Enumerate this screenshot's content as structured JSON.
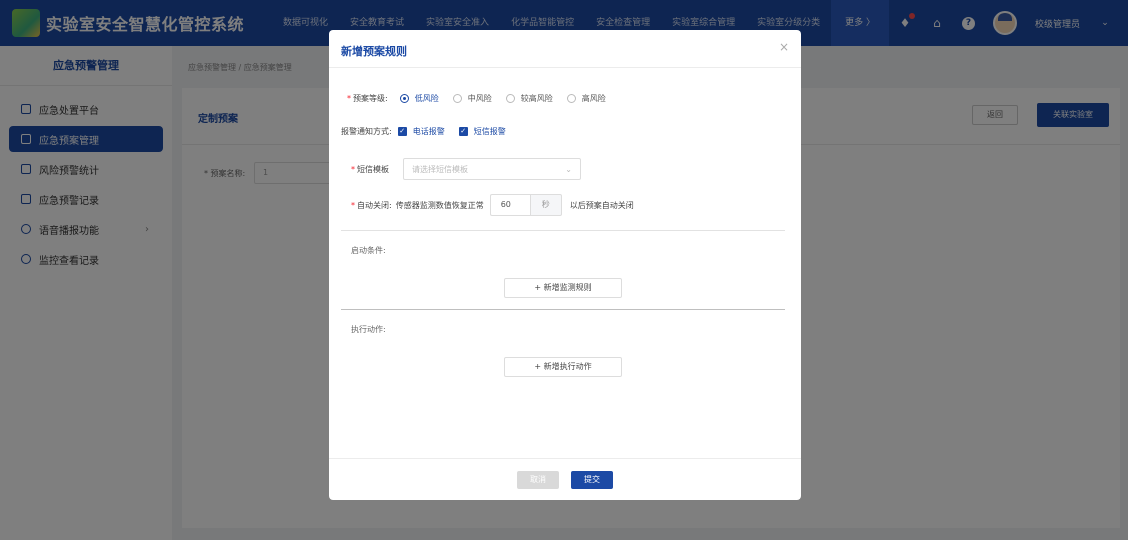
{
  "header": {
    "system_title": "实验室安全智慧化管控系统",
    "nav": [
      "数据可视化",
      "安全教育考试",
      "实验室安全准入",
      "化学品智能管控",
      "安全检查管理",
      "实验室综合管理",
      "实验室分级分类"
    ],
    "more_label": "更多 〉",
    "user_name": "校级管理员"
  },
  "sidebar": {
    "title": "应急预警管理",
    "items": [
      {
        "label": "应急处置平台"
      },
      {
        "label": "应急预案管理"
      },
      {
        "label": "风险预警统计"
      },
      {
        "label": "应急预警记录"
      },
      {
        "label": "语音播报功能"
      },
      {
        "label": "监控查看记录"
      }
    ]
  },
  "background": {
    "breadcrumb": "应急预警管理 / 应急预案管理",
    "card_title": "定制预案",
    "return_button": "返回",
    "link_lab_button": "关联实验室",
    "form_label": "* 预案名称:",
    "form_value": "1"
  },
  "modal": {
    "title": "新增预案规则",
    "close": "×",
    "level_label": "预案等级:",
    "levels": [
      "低风险",
      "中风险",
      "较高风险",
      "高风险"
    ],
    "notify_label": "报警通知方式:",
    "notify_options": [
      "电话报警",
      "短信报警"
    ],
    "sms_label": "短信模板",
    "sms_placeholder": "请选择短信模板",
    "auto_close_label": "自动关闭:",
    "auto_close_prefix": "传感器监测数值恢复正常",
    "auto_close_value": "60",
    "auto_close_unit": "秒",
    "auto_close_suffix": "以后预案自动关闭",
    "start_condition_label": "启动条件:",
    "add_monitor_rule": "+ 新增监测规则",
    "actions_label": "执行动作:",
    "add_action": "+ 新增执行动作",
    "cancel": "取消",
    "submit": "提交"
  }
}
